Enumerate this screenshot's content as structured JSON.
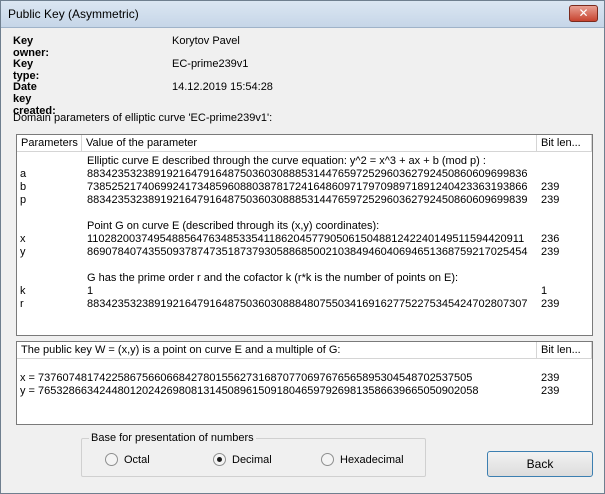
{
  "window": {
    "title": "Public Key (Asymmetric)",
    "close_glyph": "✕"
  },
  "info": {
    "owner_label": "Key owner:",
    "owner_value": "Korytov Pavel",
    "type_label": "Key type:",
    "type_value": "EC-prime239v1",
    "date_label": "Date key created:",
    "date_value": "14.12.2019 15:54:28"
  },
  "domain": {
    "caption": "Domain parameters of elliptic curve 'EC-prime239v1':",
    "headers": [
      "Parameters",
      "Value of the parameter",
      "Bit len..."
    ],
    "rows": [
      {
        "param": "",
        "value": "Elliptic curve E described through the curve equation: y^2 = x^3 + ax + b (mod p) :",
        "bits": ""
      },
      {
        "param": "a",
        "value": "883423532389192164791648750360308885314476597252960362792450860609699836",
        "bits": ""
      },
      {
        "param": "b",
        "value": "738525217406992417348596088038781724164860971797098971891240423363193866",
        "bits": "239"
      },
      {
        "param": "p",
        "value": "883423532389192164791648750360308885314476597252960362792450860609699839",
        "bits": "239"
      },
      {
        "param": "",
        "value": "",
        "bits": ""
      },
      {
        "param": "",
        "value": "Point G on curve E (described through its (x,y) coordinates):",
        "bits": ""
      },
      {
        "param": "x",
        "value": "110282003749548856476348533541186204577905061504881242240149511594420911",
        "bits": "236"
      },
      {
        "param": "y",
        "value": "869078407435509378747351873793058868500210384946040694651368759217025454",
        "bits": "239"
      },
      {
        "param": "",
        "value": "",
        "bits": ""
      },
      {
        "param": "",
        "value": "G has the prime order r and the cofactor k (r*k is the number of points on E):",
        "bits": ""
      },
      {
        "param": "k",
        "value": "1",
        "bits": "1"
      },
      {
        "param": "r",
        "value": "883423532389192164791648750360308884807550341691627752275345424702807307",
        "bits": "239"
      }
    ]
  },
  "pubkey": {
    "headers": [
      "The public key W = (x,y) is a point on curve E and a multiple of G:",
      "Bit len..."
    ],
    "rows": [
      {
        "value": "x = 737607481742258675660668427801556273168707706976765658953045487025375​05",
        "bits": "239"
      },
      {
        "value": "y = 765328663424480120242698081314508961509180465979269813586639665050902058",
        "bits": "239"
      }
    ]
  },
  "base": {
    "title": "Base for presentation of numbers",
    "options": [
      {
        "label": "Octal",
        "selected": false
      },
      {
        "label": "Decimal",
        "selected": true
      },
      {
        "label": "Hexadecimal",
        "selected": false
      }
    ]
  },
  "back_label": "Back"
}
